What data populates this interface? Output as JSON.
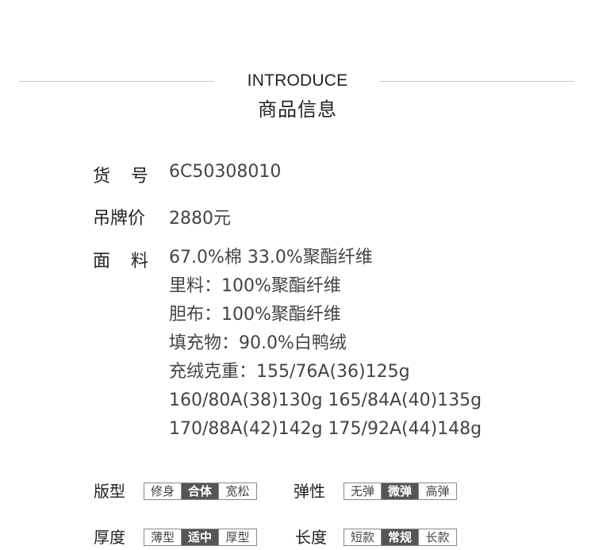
{
  "header": {
    "title_en": "INTRODUCE",
    "title_cn": "商品信息"
  },
  "info": {
    "sku_label_1": "货",
    "sku_label_2": "号",
    "sku_value": "6C50308010",
    "price_label": "吊牌价",
    "price_value": "2880元",
    "fabric_label_1": "面",
    "fabric_label_2": "料",
    "fabric_lines": [
      "67.0%棉 33.0%聚酯纤维",
      "里料：100%聚酯纤维",
      "胆布：100%聚酯纤维",
      "填充物：90.0%白鸭绒",
      "充绒克重：155/76A(36)125g",
      "160/80A(38)130g 165/84A(40)135g",
      "170/88A(42)142g 175/92A(44)148g"
    ]
  },
  "attributes": {
    "fit": {
      "label": "版型",
      "options": [
        "修身",
        "合体",
        "宽松"
      ],
      "selected": "合体"
    },
    "elasticity": {
      "label": "弹性",
      "options": [
        "无弹",
        "微弹",
        "高弹"
      ],
      "selected": "微弹"
    },
    "thickness": {
      "label": "厚度",
      "options": [
        "薄型",
        "适中",
        "厚型"
      ],
      "selected": "适中"
    },
    "length": {
      "label": "长度",
      "options": [
        "短款",
        "常规",
        "长款"
      ],
      "selected": "常规"
    }
  }
}
